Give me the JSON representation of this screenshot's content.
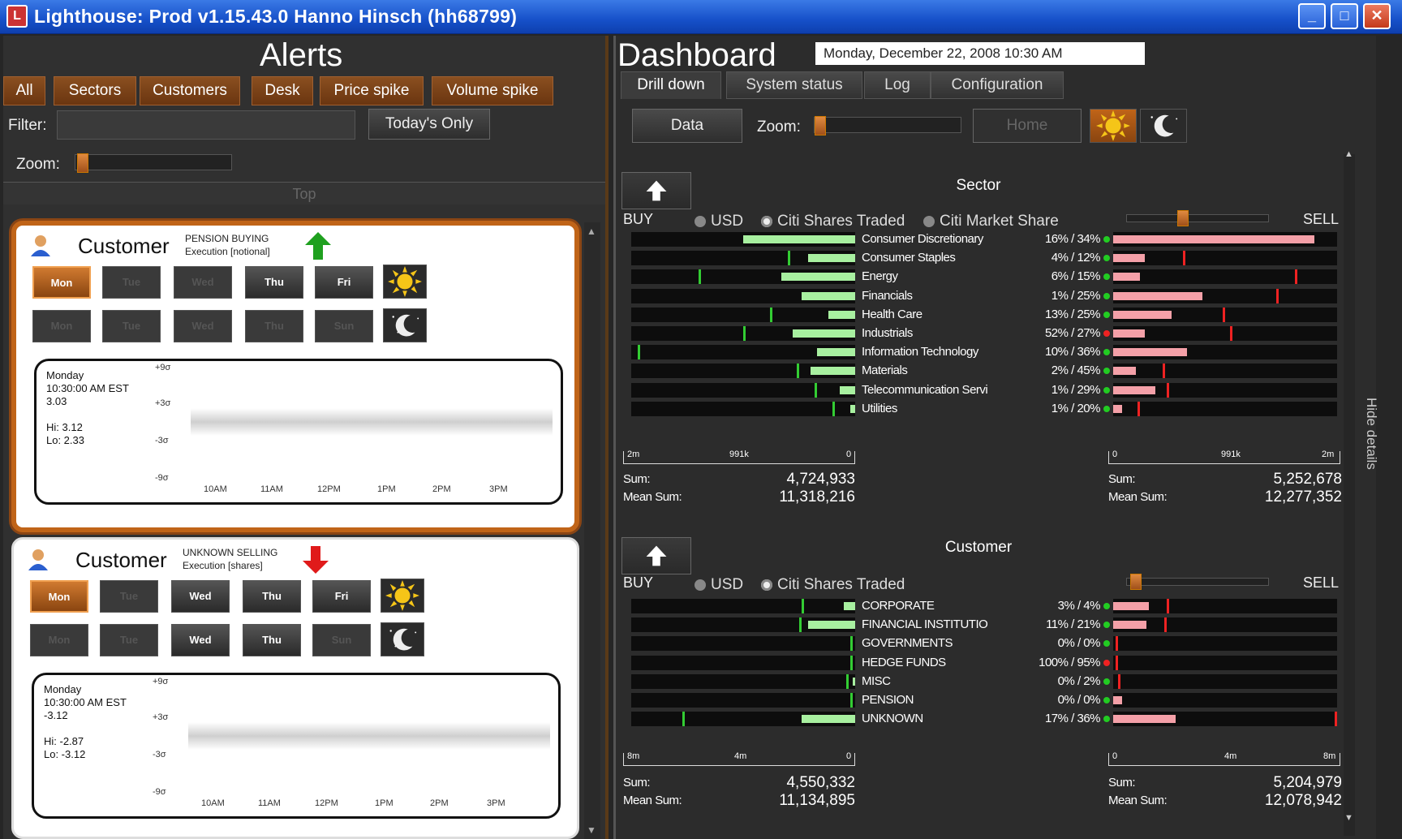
{
  "window": {
    "title": "Lighthouse: Prod v1.15.43.0 Hanno Hinsch (hh68799)"
  },
  "alerts": {
    "title": "Alerts",
    "buttons": [
      "All",
      "Sectors",
      "Customers",
      "Desk",
      "Price spike",
      "Volume spike"
    ],
    "filter_label": "Filter:",
    "filter_value": "",
    "todays_only": "Today's Only",
    "zoom_label": "Zoom:",
    "zoom_level": 0.05,
    "top_label": "Top",
    "cards": [
      {
        "title": "Customer",
        "type_line1": "PENSION BUYING",
        "type_line2": "Execution [notional]",
        "direction": "up",
        "direction_color": "#1fa01f",
        "days_row1": [
          "Mon",
          "Tue",
          "Wed",
          "Thu",
          "Fri"
        ],
        "days_row2": [
          "Mon",
          "Tue",
          "Wed",
          "Thu",
          "Sun"
        ],
        "info": [
          "Monday",
          "10:30:00 AM EST",
          "3.03",
          "",
          "Hi: 3.12",
          "Lo: 2.33"
        ],
        "y_labels": [
          "+9σ",
          "+3σ",
          "-3σ",
          "-9σ"
        ],
        "x_labels": [
          "10AM",
          "11AM",
          "12PM",
          "1PM",
          "2PM",
          "3PM"
        ]
      },
      {
        "title": "Customer",
        "type_line1": "UNKNOWN SELLING",
        "type_line2": "Execution [shares]",
        "direction": "down",
        "direction_color": "#e01a1a",
        "days_row1": [
          "Mon",
          "Tue",
          "Wed",
          "Thu",
          "Fri"
        ],
        "days_row2": [
          "Mon",
          "Tue",
          "Wed",
          "Thu",
          "Sun"
        ],
        "info": [
          "Monday",
          "10:30:00 AM EST",
          "-3.12",
          "",
          "Hi: -2.87",
          "Lo: -3.12"
        ],
        "y_labels": [
          "+9σ",
          "+3σ",
          "-3σ",
          "-9σ"
        ],
        "x_labels": [
          "10AM",
          "11AM",
          "12PM",
          "1PM",
          "2PM",
          "3PM"
        ]
      }
    ]
  },
  "dashboard": {
    "title": "Dashboard",
    "datetime": "Monday, December 22, 2008 10:30 AM",
    "tabs": [
      "Drill down",
      "System status",
      "Log",
      "Configuration"
    ],
    "data_btn": "Data",
    "zoom_label": "Zoom:",
    "zoom_level": 0.02,
    "home_btn": "Home",
    "hide_details": "Hide details",
    "sector": {
      "title": "Sector",
      "buy": "BUY",
      "sell": "SELL",
      "radios": [
        "USD",
        "Citi Shares Traded",
        "Citi Market Share"
      ],
      "rows": [
        {
          "name": "Consumer Discretionary",
          "pct": "16% / 34%",
          "dot": "#2c2",
          "buy": 0.5,
          "buym": 0.0,
          "sell": 0.9,
          "sellm": 0.0
        },
        {
          "name": "Consumer Staples",
          "pct": "4% / 12%",
          "dot": "#2c2",
          "buy": 0.21,
          "buym": 0.29,
          "sell": 0.14,
          "sellm": 0.31
        },
        {
          "name": "Energy",
          "pct": "6% / 15%",
          "dot": "#2c2",
          "buy": 0.33,
          "buym": 0.69,
          "sell": 0.12,
          "sellm": 0.81
        },
        {
          "name": "Financials",
          "pct": "1% / 25%",
          "dot": "#2c2",
          "buy": 0.24,
          "buym": 0.0,
          "sell": 0.4,
          "sellm": 0.73
        },
        {
          "name": "Health Care",
          "pct": "13% / 25%",
          "dot": "#2c2",
          "buy": 0.12,
          "buym": 0.37,
          "sell": 0.26,
          "sellm": 0.49
        },
        {
          "name": "Industrials",
          "pct": "52% / 27%",
          "dot": "#e22",
          "buy": 0.28,
          "buym": 0.49,
          "sell": 0.14,
          "sellm": 0.52
        },
        {
          "name": "Information Technology",
          "pct": "10% / 36%",
          "dot": "#2c2",
          "buy": 0.17,
          "buym": 0.96,
          "sell": 0.33,
          "sellm": 0.0
        },
        {
          "name": "Materials",
          "pct": "2% / 45%",
          "dot": "#2c2",
          "buy": 0.2,
          "buym": 0.25,
          "sell": 0.1,
          "sellm": 0.22
        },
        {
          "name": "Telecommunication Servi",
          "pct": "1% / 29%",
          "dot": "#2c2",
          "buy": 0.07,
          "buym": 0.17,
          "sell": 0.19,
          "sellm": 0.24
        },
        {
          "name": "Utilities",
          "pct": "1% / 20%",
          "dot": "#2c2",
          "buy": 0.02,
          "buym": 0.09,
          "sell": 0.04,
          "sellm": 0.11
        }
      ],
      "axis_left": [
        "2m",
        "991k",
        "0"
      ],
      "axis_right": [
        "0",
        "991k",
        "2m"
      ],
      "sum_label": "Sum:",
      "mean_label": "Mean Sum:",
      "buy_sum": "4,724,933",
      "buy_mean": "11,318,216",
      "sell_sum": "5,252,678",
      "sell_mean": "12,277,352"
    },
    "customer": {
      "title": "Customer",
      "buy": "BUY",
      "sell": "SELL",
      "radios": [
        "USD",
        "Citi Shares Traded"
      ],
      "rows": [
        {
          "name": "CORPORATE",
          "pct": "3% / 4%",
          "dot": "#2c2",
          "buy": 0.05,
          "buym": 0.23,
          "sell": 0.16,
          "sellm": 0.24
        },
        {
          "name": "FINANCIAL INSTITUTIO",
          "pct": "11% / 21%",
          "dot": "#2c2",
          "buy": 0.21,
          "buym": 0.24,
          "sell": 0.15,
          "sellm": 0.23
        },
        {
          "name": "GOVERNMENTS",
          "pct": "0% / 0%",
          "dot": "#2c2",
          "buy": 0.0,
          "buym": 0.01,
          "sell": 0.0,
          "sellm": 0.01
        },
        {
          "name": "HEDGE FUNDS",
          "pct": "100% / 95%",
          "dot": "#e22",
          "buy": 0.0,
          "buym": 0.01,
          "sell": 0.0,
          "sellm": 0.01
        },
        {
          "name": "MISC",
          "pct": "0% / 2%",
          "dot": "#2c2",
          "buy": 0.01,
          "buym": 0.03,
          "sell": 0.0,
          "sellm": 0.02
        },
        {
          "name": "PENSION",
          "pct": "0% / 0%",
          "dot": "#2c2",
          "buy": 0.0,
          "buym": 0.01,
          "sell": 0.04,
          "sellm": 0.0
        },
        {
          "name": "UNKNOWN",
          "pct": "17% / 36%",
          "dot": "#2c2",
          "buy": 0.24,
          "buym": 0.76,
          "sell": 0.28,
          "sellm": 0.99
        }
      ],
      "axis_left": [
        "8m",
        "4m",
        "0"
      ],
      "axis_right": [
        "0",
        "4m",
        "8m"
      ],
      "sum_label": "Sum:",
      "mean_label": "Mean Sum:",
      "buy_sum": "4,550,332",
      "buy_mean": "11,134,895",
      "sell_sum": "5,204,979",
      "sell_mean": "12,078,942"
    }
  }
}
